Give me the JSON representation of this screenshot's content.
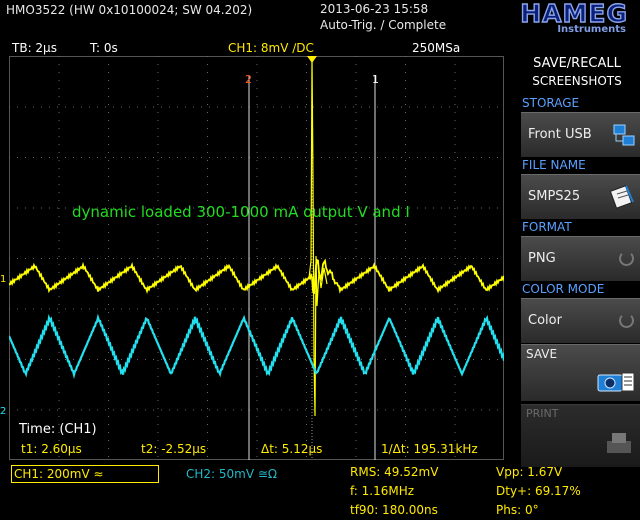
{
  "header": {
    "device": "HMO3522 (HW 0x10100024; SW 04.202)",
    "datetime": "2013-06-23 15:58",
    "trigger_status": "Auto-Trig. / Complete",
    "logo_main": "HAMEG",
    "logo_sub": "Instruments"
  },
  "info_bar": {
    "timebase": "TB: 2µs",
    "trigger_time": "T: 0s",
    "channel_setting": "CH1: 8mV ∕DC",
    "sample_rate": "250MSa"
  },
  "screen": {
    "annotation": "dynamic loaded 300-1000 mA output V and I",
    "cursor1_label": "1",
    "cursor2_label": "2",
    "ch1_marker": "1",
    "ch2_marker": "2",
    "measure_title": "Time: (CH1)",
    "t1": "t1: 2.60µs",
    "t2": "t2: -2.52µs",
    "dt": "Δt: 5.12µs",
    "inv_dt": "1/Δt: 195.31kHz",
    "ch1_color": "#ffff00",
    "ch2_color": "#22e0ee"
  },
  "side_menu": {
    "title1": "SAVE/RECALL",
    "title2": "SCREENSHOTS",
    "storage_label": "STORAGE",
    "storage_value": "Front USB",
    "filename_label": "FILE NAME",
    "filename_value": "SMPS25",
    "format_label": "FORMAT",
    "format_value": "PNG",
    "colormode_label": "COLOR MODE",
    "colormode_value": "Color",
    "save_label": "SAVE",
    "print_label": "PRINT"
  },
  "bottom": {
    "ch1_setting": "CH1: 200mV ≈",
    "ch2_setting": "CH2: 50mV ≅Ω",
    "rms": "RMS: 49.52mV",
    "freq": "f: 1.16MHz",
    "tf90": "tf90: 180.00ns",
    "vpp": "Vpp: 1.67V",
    "duty": "Dty+: 69.17%",
    "phase": "Phs: 0°"
  }
}
